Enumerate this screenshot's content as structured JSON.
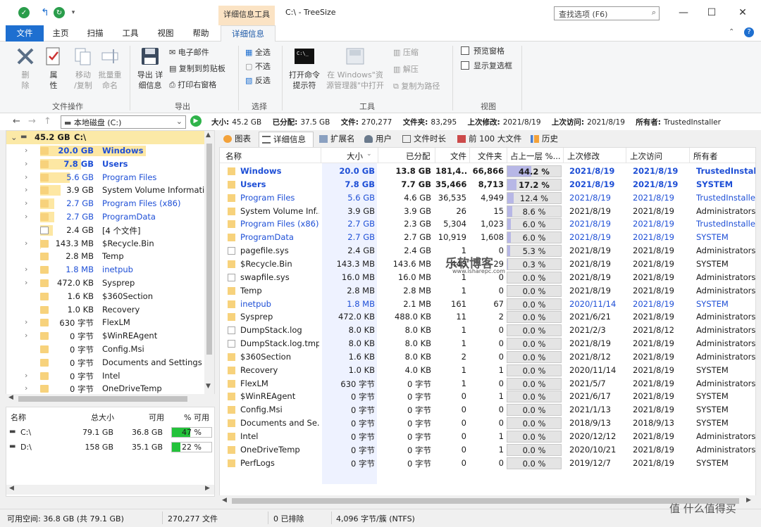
{
  "window": {
    "context_tab": "详细信息工具",
    "title": "C:\\ - TreeSize",
    "search_placeholder": "查找选项 (F6)",
    "minimize": "—",
    "maximize": "☐",
    "close": "✕"
  },
  "ribbon_tabs": [
    "文件",
    "主页",
    "扫描",
    "工具",
    "视图",
    "帮助",
    "详细信息"
  ],
  "ribbon": {
    "file_ops": {
      "label": "文件操作",
      "delete": "删\n除",
      "properties": "属\n性",
      "move_copy": "移动\n/复制",
      "batch_rename": "批量重\n命名"
    },
    "export": {
      "label": "导出",
      "export_details": "导出 详\n细信息",
      "email": "电子邮件",
      "copy_clipboard": "复制到剪贴板",
      "print_right": "打印右窗格"
    },
    "select": {
      "label": "选择",
      "select_all": "全选",
      "select_none": "不选",
      "invert": "反选"
    },
    "tools": {
      "label": "工具",
      "cmd": "打开命令\n提示符",
      "open_explorer": "在 Windows\"资\n源管理器\"中打开",
      "compress": "压缩",
      "decompress": "解压",
      "copy_path": "复制为路径"
    },
    "view": {
      "label": "视图",
      "preview_pane": "预览窗格",
      "show_checkbox": "显示复选框"
    }
  },
  "address": {
    "path": "本地磁盘 (C:)",
    "info": {
      "size_label": "大小:",
      "size": "45.2 GB",
      "allocated_label": "已分配:",
      "allocated": "37.5 GB",
      "files_label": "文件:",
      "files": "270,277",
      "folders_label": "文件夹:",
      "folders": "83,295",
      "modified_label": "上次修改:",
      "modified": "2021/8/19",
      "accessed_label": "上次访问:",
      "accessed": "2021/8/19",
      "owner_label": "所有者:",
      "owner": "TrustedInstaller"
    }
  },
  "tree": {
    "root_size": "45.2 GB",
    "root_name": "C:\\",
    "items": [
      {
        "size": "20.0 GB",
        "name": "Windows",
        "pct": 44.2,
        "blue": true,
        "bold": true,
        "exp": true
      },
      {
        "size": "7.8 GB",
        "name": "Users",
        "pct": 17.2,
        "blue": true,
        "bold": true,
        "exp": true
      },
      {
        "size": "5.6 GB",
        "name": "Program Files",
        "pct": 12.4,
        "blue": true,
        "bold": false,
        "exp": true
      },
      {
        "size": "3.9 GB",
        "name": "System Volume Informatio",
        "pct": 8.6,
        "blue": false,
        "bold": false,
        "exp": true
      },
      {
        "size": "2.7 GB",
        "name": "Program Files (x86)",
        "pct": 6.0,
        "blue": true,
        "bold": false,
        "exp": true
      },
      {
        "size": "2.7 GB",
        "name": "ProgramData",
        "pct": 6.0,
        "blue": true,
        "bold": false,
        "exp": true
      },
      {
        "size": "2.4 GB",
        "name": "[4 个文件]",
        "pct": 5.3,
        "blue": false,
        "bold": false,
        "exp": false
      },
      {
        "size": "143.3 MB",
        "name": "$Recycle.Bin",
        "pct": 0.3,
        "blue": false,
        "bold": false,
        "exp": true
      },
      {
        "size": "2.8 MB",
        "name": "Temp",
        "pct": 0,
        "blue": false,
        "bold": false,
        "exp": false
      },
      {
        "size": "1.8 MB",
        "name": "inetpub",
        "pct": 0,
        "blue": true,
        "bold": false,
        "exp": true
      },
      {
        "size": "472.0 KB",
        "name": "Sysprep",
        "pct": 0,
        "blue": false,
        "bold": false,
        "exp": true
      },
      {
        "size": "1.6 KB",
        "name": "$360Section",
        "pct": 0,
        "blue": false,
        "bold": false,
        "exp": false
      },
      {
        "size": "1.0 KB",
        "name": "Recovery",
        "pct": 0,
        "blue": false,
        "bold": false,
        "exp": false
      },
      {
        "size": "630 字节",
        "name": "FlexLM",
        "pct": 0,
        "blue": false,
        "bold": false,
        "exp": true
      },
      {
        "size": "0 字节",
        "name": "$WinREAgent",
        "pct": 0,
        "blue": false,
        "bold": false,
        "exp": true
      },
      {
        "size": "0 字节",
        "name": "Config.Msi",
        "pct": 0,
        "blue": false,
        "bold": false,
        "exp": false
      },
      {
        "size": "0 字节",
        "name": "Documents and Settings",
        "pct": 0,
        "blue": false,
        "bold": false,
        "exp": false
      },
      {
        "size": "0 字节",
        "name": "Intel",
        "pct": 0,
        "blue": false,
        "bold": false,
        "exp": true
      },
      {
        "size": "0 字节",
        "name": "OneDriveTemp",
        "pct": 0,
        "blue": false,
        "bold": false,
        "exp": true
      }
    ]
  },
  "drives": {
    "headers": [
      "名称",
      "总大小",
      "可用",
      "% 可用"
    ],
    "rows": [
      {
        "name": "C:\\",
        "total": "79.1 GB",
        "free": "36.8 GB",
        "pct_label": "47 %",
        "pct": 47
      },
      {
        "name": "D:\\",
        "total": "158 GB",
        "free": "35.1 GB",
        "pct_label": "22 %",
        "pct": 22
      }
    ]
  },
  "view_tabs": [
    "图表",
    "详细信息",
    "扩展名",
    "用户",
    "文件时长",
    "前 100 大文件",
    "历史"
  ],
  "grid": {
    "headers": [
      "名称",
      "大小",
      "已分配",
      "文件",
      "文件夹",
      "占上一层 %...",
      "上次修改",
      "上次访问",
      "所有者"
    ],
    "rows": [
      {
        "name": "Windows",
        "size": "20.0 GB",
        "alloc": "13.8 GB",
        "files": "181,4...",
        "folders": "66,866",
        "pct_label": "44.2 %",
        "pct": 44.2,
        "mod": "2021/8/19",
        "acc": "2021/8/19",
        "owner": "TrustedInstaller",
        "style": "bold",
        "type": "folder"
      },
      {
        "name": "Users",
        "size": "7.8 GB",
        "alloc": "7.7 GB",
        "files": "35,466",
        "folders": "8,713",
        "pct_label": "17.2 %",
        "pct": 17.2,
        "mod": "2021/8/19",
        "acc": "2021/8/19",
        "owner": "SYSTEM",
        "style": "bold",
        "type": "folder"
      },
      {
        "name": "Program Files",
        "size": "5.6 GB",
        "alloc": "4.6 GB",
        "files": "36,535",
        "folders": "4,949",
        "pct_label": "12.4 %",
        "pct": 12.4,
        "mod": "2021/8/19",
        "acc": "2021/8/19",
        "owner": "TrustedInstaller",
        "style": "blue",
        "type": "folder"
      },
      {
        "name": "System Volume Inf...",
        "size": "3.9 GB",
        "alloc": "3.9 GB",
        "files": "26",
        "folders": "15",
        "pct_label": "8.6 %",
        "pct": 8.6,
        "mod": "2021/8/19",
        "acc": "2021/8/19",
        "owner": "Administrators",
        "style": "plain",
        "type": "folder"
      },
      {
        "name": "Program Files (x86)",
        "size": "2.7 GB",
        "alloc": "2.3 GB",
        "files": "5,304",
        "folders": "1,023",
        "pct_label": "6.0 %",
        "pct": 6.0,
        "mod": "2021/8/19",
        "acc": "2021/8/19",
        "owner": "TrustedInstaller",
        "style": "blue",
        "type": "folder"
      },
      {
        "name": "ProgramData",
        "size": "2.7 GB",
        "alloc": "2.7 GB",
        "files": "10,919",
        "folders": "1,608",
        "pct_label": "6.0 %",
        "pct": 6.0,
        "mod": "2021/8/19",
        "acc": "2021/8/19",
        "owner": "SYSTEM",
        "style": "blue",
        "type": "folder"
      },
      {
        "name": "pagefile.sys",
        "size": "2.4 GB",
        "alloc": "2.4 GB",
        "files": "1",
        "folders": "0",
        "pct_label": "5.3 %",
        "pct": 5.3,
        "mod": "2021/8/19",
        "acc": "2021/8/19",
        "owner": "Administrators",
        "style": "plain",
        "type": "file"
      },
      {
        "name": "$Recycle.Bin",
        "size": "143.3 MB",
        "alloc": "143.6 MB",
        "files": "443",
        "folders": "29",
        "pct_label": "0.3 %",
        "pct": 0.3,
        "mod": "2021/8/19",
        "acc": "2021/8/19",
        "owner": "SYSTEM",
        "style": "plain",
        "type": "folder"
      },
      {
        "name": "swapfile.sys",
        "size": "16.0 MB",
        "alloc": "16.0 MB",
        "files": "1",
        "folders": "0",
        "pct_label": "0.0 %",
        "pct": 0,
        "mod": "2021/8/19",
        "acc": "2021/8/19",
        "owner": "Administrators",
        "style": "plain",
        "type": "file"
      },
      {
        "name": "Temp",
        "size": "2.8 MB",
        "alloc": "2.8 MB",
        "files": "1",
        "folders": "0",
        "pct_label": "0.0 %",
        "pct": 0,
        "mod": "2021/8/19",
        "acc": "2021/8/19",
        "owner": "Administrators",
        "style": "plain",
        "type": "folder"
      },
      {
        "name": "inetpub",
        "size": "1.8 MB",
        "alloc": "2.1 MB",
        "files": "161",
        "folders": "67",
        "pct_label": "0.0 %",
        "pct": 0,
        "mod": "2020/11/14",
        "acc": "2021/8/19",
        "owner": "SYSTEM",
        "style": "blue",
        "type": "folder"
      },
      {
        "name": "Sysprep",
        "size": "472.0 KB",
        "alloc": "488.0 KB",
        "files": "11",
        "folders": "2",
        "pct_label": "0.0 %",
        "pct": 0,
        "mod": "2021/6/21",
        "acc": "2021/8/19",
        "owner": "Administrators",
        "style": "plain",
        "type": "folder"
      },
      {
        "name": "DumpStack.log",
        "size": "8.0 KB",
        "alloc": "8.0 KB",
        "files": "1",
        "folders": "0",
        "pct_label": "0.0 %",
        "pct": 0,
        "mod": "2021/2/3",
        "acc": "2021/8/12",
        "owner": "Administrators",
        "style": "plain",
        "type": "file"
      },
      {
        "name": "DumpStack.log.tmp",
        "size": "8.0 KB",
        "alloc": "8.0 KB",
        "files": "1",
        "folders": "0",
        "pct_label": "0.0 %",
        "pct": 0,
        "mod": "2021/8/19",
        "acc": "2021/8/19",
        "owner": "Administrators",
        "style": "plain",
        "type": "file"
      },
      {
        "name": "$360Section",
        "size": "1.6 KB",
        "alloc": "8.0 KB",
        "files": "2",
        "folders": "0",
        "pct_label": "0.0 %",
        "pct": 0,
        "mod": "2021/8/12",
        "acc": "2021/8/19",
        "owner": "Administrators",
        "style": "plain",
        "type": "folder"
      },
      {
        "name": "Recovery",
        "size": "1.0 KB",
        "alloc": "4.0 KB",
        "files": "1",
        "folders": "1",
        "pct_label": "0.0 %",
        "pct": 0,
        "mod": "2020/11/14",
        "acc": "2021/8/19",
        "owner": "SYSTEM",
        "style": "plain",
        "type": "folder"
      },
      {
        "name": "FlexLM",
        "size": "630 字节",
        "alloc": "0 字节",
        "files": "1",
        "folders": "0",
        "pct_label": "0.0 %",
        "pct": 0,
        "mod": "2021/5/7",
        "acc": "2021/8/19",
        "owner": "Administrators",
        "style": "plain",
        "type": "folder"
      },
      {
        "name": "$WinREAgent",
        "size": "0 字节",
        "alloc": "0 字节",
        "files": "0",
        "folders": "1",
        "pct_label": "0.0 %",
        "pct": 0,
        "mod": "2021/6/17",
        "acc": "2021/8/19",
        "owner": "SYSTEM",
        "style": "plain",
        "type": "folder"
      },
      {
        "name": "Config.Msi",
        "size": "0 字节",
        "alloc": "0 字节",
        "files": "0",
        "folders": "0",
        "pct_label": "0.0 %",
        "pct": 0,
        "mod": "2021/1/13",
        "acc": "2021/8/19",
        "owner": "SYSTEM",
        "style": "plain",
        "type": "folder"
      },
      {
        "name": "Documents and Se...",
        "size": "0 字节",
        "alloc": "0 字节",
        "files": "0",
        "folders": "0",
        "pct_label": "0.0 %",
        "pct": 0,
        "mod": "2018/9/13",
        "acc": "2018/9/13",
        "owner": "SYSTEM",
        "style": "plain",
        "type": "folder"
      },
      {
        "name": "Intel",
        "size": "0 字节",
        "alloc": "0 字节",
        "files": "0",
        "folders": "1",
        "pct_label": "0.0 %",
        "pct": 0,
        "mod": "2020/12/12",
        "acc": "2021/8/19",
        "owner": "Administrators",
        "style": "plain",
        "type": "folder"
      },
      {
        "name": "OneDriveTemp",
        "size": "0 字节",
        "alloc": "0 字节",
        "files": "0",
        "folders": "1",
        "pct_label": "0.0 %",
        "pct": 0,
        "mod": "2020/10/21",
        "acc": "2021/8/19",
        "owner": "Administrators",
        "style": "plain",
        "type": "folder"
      },
      {
        "name": "PerfLogs",
        "size": "0 字节",
        "alloc": "0 字节",
        "files": "0",
        "folders": "0",
        "pct_label": "0.0 %",
        "pct": 0,
        "mod": "2019/12/7",
        "acc": "2021/8/19",
        "owner": "SYSTEM",
        "style": "plain",
        "type": "folder"
      }
    ]
  },
  "status": {
    "free": "可用空间: 36.8 GB (共 79.1 GB)",
    "files": "270,277 文件",
    "excluded": "0 已排除",
    "cluster": "4,096 字节/簇 (NTFS)"
  },
  "watermark": {
    "main": "乐软博客",
    "sub": "www.isharepc.com"
  },
  "corner_watermark": "值 什么值得买",
  "colors": {
    "accent": "#1e6fd0",
    "blue_text": "#1e4fd6",
    "tree_bar": "#fde7a3",
    "pct_bar": "#b7b7e6",
    "drive_bar": "#23c23a"
  }
}
